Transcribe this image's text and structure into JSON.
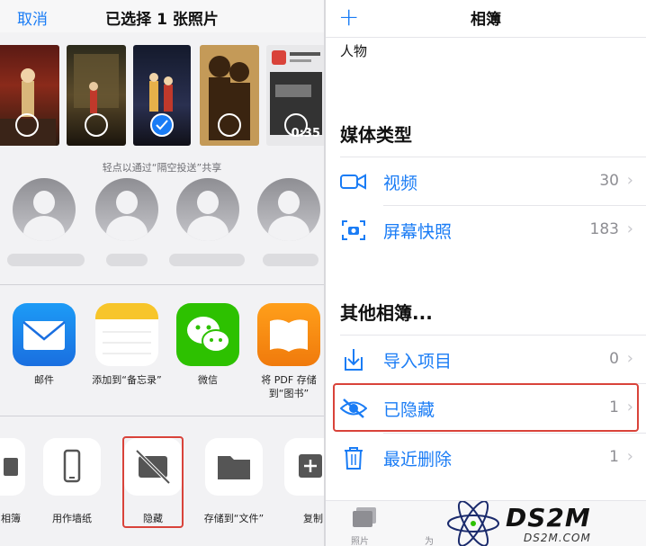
{
  "left": {
    "cancel_label": "取消",
    "title": "已选择 1 张照片",
    "photos": [
      {
        "selected": false,
        "duration": ""
      },
      {
        "selected": false,
        "duration": ""
      },
      {
        "selected": true,
        "duration": ""
      },
      {
        "selected": false,
        "duration": ""
      },
      {
        "selected": false,
        "duration": "0:35"
      }
    ],
    "airdrop_hint": "轻点以通过“隔空投送”共享",
    "apps": [
      {
        "label": "邮件",
        "icon": "mail-icon"
      },
      {
        "label": "添加到“备忘录”",
        "icon": "notes-icon"
      },
      {
        "label": "微信",
        "icon": "wechat-icon"
      },
      {
        "label": "将 PDF 存储到“图书”",
        "icon": "books-icon"
      }
    ],
    "actions": [
      {
        "label": "相簿",
        "icon": "album-icon"
      },
      {
        "label": "用作墙纸",
        "icon": "phone-icon"
      },
      {
        "label": "隐藏",
        "icon": "hide-icon"
      },
      {
        "label": "存储到“文件”",
        "icon": "folder-icon"
      },
      {
        "label": "复制",
        "icon": "copy-icon"
      }
    ]
  },
  "right": {
    "title": "相簿",
    "people_label": "人物",
    "media_section": "媒体类型",
    "media_rows": [
      {
        "label": "视频",
        "count": "30",
        "icon": "video-icon"
      },
      {
        "label": "屏幕快照",
        "count": "183",
        "icon": "screenshot-icon"
      }
    ],
    "other_section": "其他相簿...",
    "other_rows": [
      {
        "label": "导入项目",
        "count": "0",
        "icon": "import-icon"
      },
      {
        "label": "已隐藏",
        "count": "1",
        "icon": "eye-slash-icon"
      },
      {
        "label": "最近删除",
        "count": "1",
        "icon": "trash-icon"
      }
    ],
    "tabs": [
      {
        "label": "照片",
        "icon": "photos-icon"
      },
      {
        "label": "为",
        "icon": ""
      }
    ],
    "watermark_big": "DS2M",
    "watermark_small": "DS2M.COM"
  },
  "colors": {
    "accent": "#1a7cf5",
    "highlight": "#d9433a"
  }
}
